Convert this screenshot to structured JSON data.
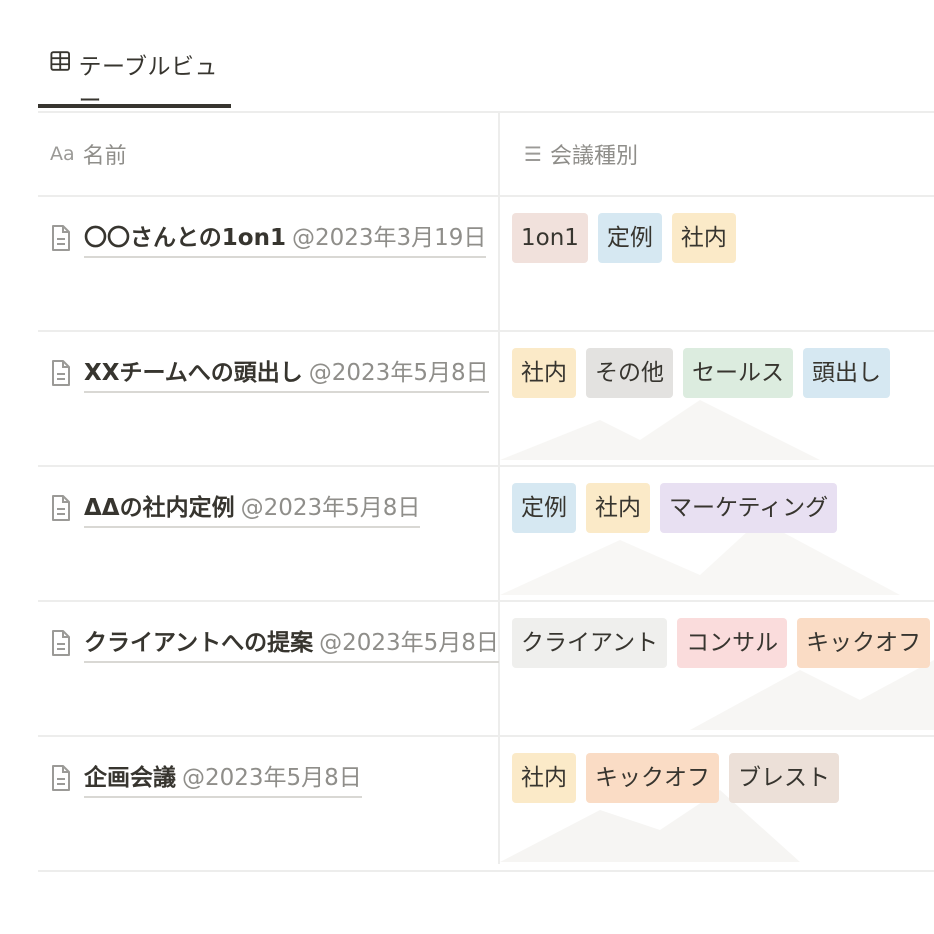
{
  "tab": {
    "label": "テーブルビュー",
    "icon": "table-icon"
  },
  "columns": [
    {
      "label": "名前",
      "icon": "text-type-icon",
      "icon_glyph": "Aa"
    },
    {
      "label": "会議種別",
      "icon": "list-icon",
      "icon_glyph": "☰"
    }
  ],
  "rows": [
    {
      "title": "〇〇さんとの1on1",
      "date": "@2023年3月19日",
      "tags": [
        {
          "label": "1on1",
          "color": "#f1e1dc"
        },
        {
          "label": "定例",
          "color": "#d6e8f2"
        },
        {
          "label": "社内",
          "color": "#fbeac8"
        }
      ]
    },
    {
      "title": "XXチームへの頭出し",
      "date": "@2023年5月8日",
      "tags": [
        {
          "label": "社内",
          "color": "#fbeac8"
        },
        {
          "label": "その他",
          "color": "#e3e2e0"
        },
        {
          "label": "セールス",
          "color": "#dcecdf"
        },
        {
          "label": "頭出し",
          "color": "#d6e8f2"
        }
      ]
    },
    {
      "title": "ΔΔの社内定例",
      "date": "@2023年5月8日",
      "tags": [
        {
          "label": "定例",
          "color": "#d6e8f2"
        },
        {
          "label": "社内",
          "color": "#fbeac8"
        },
        {
          "label": "マーケティング",
          "color": "#e8e0f2"
        }
      ]
    },
    {
      "title": "クライアントへの提案",
      "date": "@2023年5月8日",
      "tags": [
        {
          "label": "クライアント",
          "color": "#efefed"
        },
        {
          "label": "コンサル",
          "color": "#fadcdc"
        },
        {
          "label": "キックオフ",
          "color": "#fadcc5"
        }
      ]
    },
    {
      "title": "企画会議",
      "date": "@2023年5月8日",
      "tags": [
        {
          "label": "社内",
          "color": "#fbeac8"
        },
        {
          "label": "キックオフ",
          "color": "#fadcc5"
        },
        {
          "label": "ブレスト",
          "color": "#ece0d8"
        }
      ]
    }
  ]
}
